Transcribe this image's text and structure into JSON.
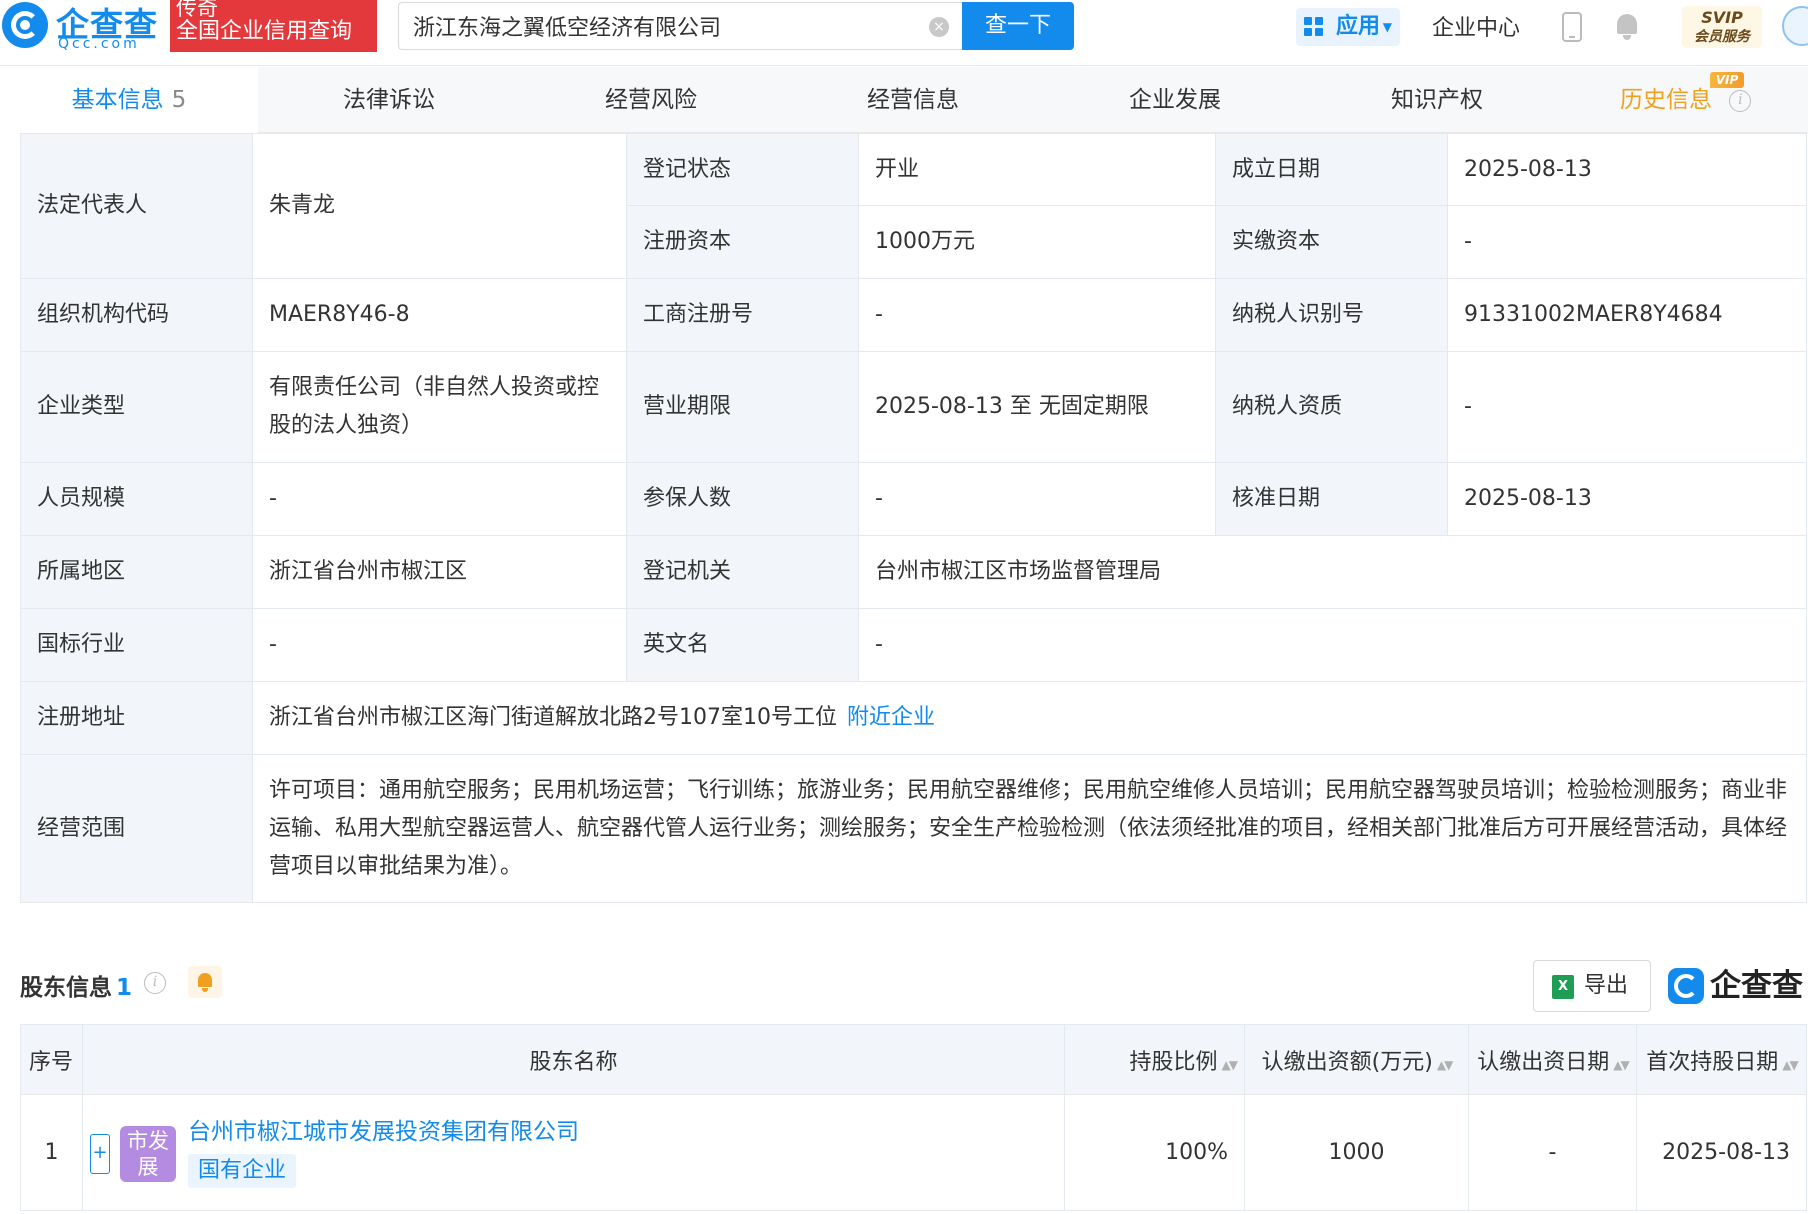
{
  "header": {
    "logo_text": "企查查",
    "logo_sub": "Qcc.com",
    "promo_line1": "传奇",
    "promo_line2": "全国企业信用查询",
    "search_value": "浙江东海之翼低空经济有限公司",
    "search_button": "查一下",
    "apps_label": "应用",
    "enterprise_center": "企业中心",
    "svip_line1": "SVIP",
    "svip_line2": "会员服务"
  },
  "tabs": [
    {
      "label": "基本信息",
      "count": "5"
    },
    {
      "label": "法律诉讼"
    },
    {
      "label": "经营风险"
    },
    {
      "label": "经营信息"
    },
    {
      "label": "企业发展"
    },
    {
      "label": "知识产权"
    },
    {
      "label": "历史信息",
      "badge": "VIP"
    }
  ],
  "info": {
    "legal_rep_label": "法定代表人",
    "legal_rep": "朱青龙",
    "reg_status_label": "登记状态",
    "reg_status": "开业",
    "found_date_label": "成立日期",
    "found_date": "2025-08-13",
    "reg_capital_label": "注册资本",
    "reg_capital": "1000万元",
    "paid_capital_label": "实缴资本",
    "paid_capital": "-",
    "org_code_label": "组织机构代码",
    "org_code": "MAER8Y46-8",
    "biz_reg_no_label": "工商注册号",
    "biz_reg_no": "-",
    "taxpayer_id_label": "纳税人识别号",
    "taxpayer_id": "91331002MAER8Y4684",
    "ent_type_label": "企业类型",
    "ent_type": "有限责任公司（非自然人投资或控股的法人独资）",
    "biz_term_label": "营业期限",
    "biz_term": "2025-08-13 至 无固定期限",
    "taxpayer_qual_label": "纳税人资质",
    "taxpayer_qual": "-",
    "staff_size_label": "人员规模",
    "staff_size": "-",
    "insured_label": "参保人数",
    "insured": "-",
    "approve_date_label": "核准日期",
    "approve_date": "2025-08-13",
    "region_label": "所属地区",
    "region": "浙江省台州市椒江区",
    "reg_authority_label": "登记机关",
    "reg_authority": "台州市椒江区市场监督管理局",
    "industry_label": "国标行业",
    "industry": "-",
    "english_name_label": "英文名",
    "english_name": "-",
    "address_label": "注册地址",
    "address": "浙江省台州市椒江区海门街道解放北路2号107室10号工位",
    "nearby_link": "附近企业",
    "scope_label": "经营范围",
    "scope": "许可项目：通用航空服务；民用机场运营；飞行训练；旅游业务；民用航空器维修；民用航空维修人员培训；民用航空器驾驶员培训；检验检测服务；商业非运输、私用大型航空器运营人、航空器代管人运行业务；测绘服务；安全生产检验检测（依法须经批准的项目，经相关部门批准后方可开展经营活动，具体经营项目以审批结果为准）。"
  },
  "shareholders": {
    "title": "股东信息",
    "count": "1",
    "export_label": "导出",
    "brand": "企查查",
    "columns": [
      "序号",
      "股东名称",
      "持股比例",
      "认缴出资额(万元)",
      "认缴出资日期",
      "首次持股日期"
    ],
    "rows": [
      {
        "index": "1",
        "logo_text": "市发展",
        "name": "台州市椒江城市发展投资集团有限公司",
        "tag": "国有企业",
        "ratio": "100%",
        "subscribed": "1000",
        "subscribed_date": "-",
        "first_hold_date": "2025-08-13"
      }
    ]
  },
  "colors": {
    "brand_blue": "#128bed",
    "promo_red": "#e4393c",
    "label_bg": "#f2f6fa",
    "vip_orange": "#f0a020"
  }
}
